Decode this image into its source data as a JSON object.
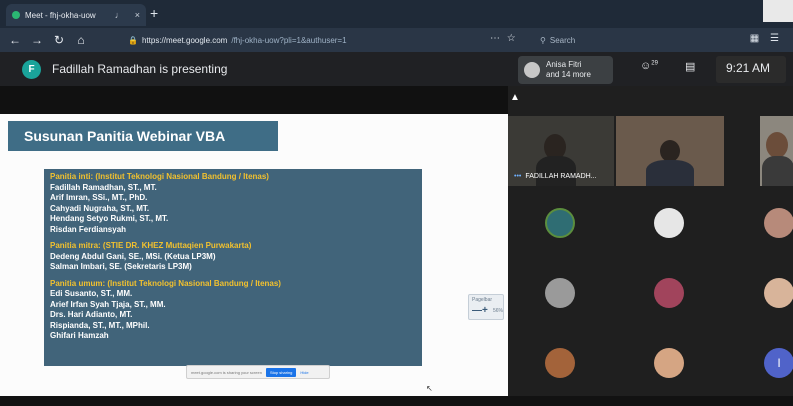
{
  "browser": {
    "tab_title": "Meet - fhj-okha-uow",
    "tab_close": "×",
    "sound_icon": "speaker-icon",
    "new_tab": "+",
    "url_host": "https://meet.google.com",
    "url_path": "/fhj-okha-uow?pli=1&authuser=1",
    "search_placeholder": "Search"
  },
  "meet": {
    "presenter_initial": "F",
    "presenting_text": "Fadillah Ramadhan is presenting",
    "participants_name": "Anisa Fitri",
    "participants_more": "and 14 more",
    "people_count": "29",
    "time": "9:21 AM"
  },
  "slide": {
    "title": "Susunan Panitia Webinar VBA",
    "lines": [
      {
        "type": "h",
        "text": "Panitia inti: (Institut Teknologi Nasional Bandung / Itenas)"
      },
      {
        "type": "n",
        "text": "Fadillah Ramadhan, ST., MT."
      },
      {
        "type": "n",
        "text": "Arif Imran, SSi., MT., PhD."
      },
      {
        "type": "n",
        "text": "Cahyadi Nugraha, ST., MT."
      },
      {
        "type": "n",
        "text": "Hendang Setyo Rukmi, ST., MT."
      },
      {
        "type": "n",
        "text": "Risdan Ferdiansyah"
      },
      {
        "type": "gap",
        "text": ""
      },
      {
        "type": "h",
        "text": "Panitia mitra: (STIE DR. KHEZ Muttaqien Purwakarta)"
      },
      {
        "type": "n",
        "text": "Dedeng Abdul Gani, SE., MSi. (Ketua LP3M)"
      },
      {
        "type": "n",
        "text": "Salman Imbari, SE. (Sekretaris LP3M)"
      },
      {
        "type": "gap",
        "text": ""
      },
      {
        "type": "h",
        "text": "Panitia umum: (Institut Teknologi Nasional Bandung / Itenas)"
      },
      {
        "type": "n",
        "text": "Edi Susanto, ST., MM."
      },
      {
        "type": "n",
        "text": "Arief Irfan Syah Tjaja, ST., MM."
      },
      {
        "type": "n",
        "text": "Drs. Hari Adianto, MT."
      },
      {
        "type": "n",
        "text": "Rispianda, ST., MT., MPhil."
      },
      {
        "type": "n",
        "text": "Ghifari Hamzah"
      }
    ],
    "zoom_title": "Pagelbar",
    "zoom_buttons": "—+",
    "zoom_value": "56%",
    "share_text": "meet.google.com is sharing your screen",
    "stop_label": "Stop sharing",
    "hide_label": "Hide"
  },
  "grid": {
    "speaker_name": "FADILLAH RAMADH...",
    "speaker_dots": "•••",
    "last_initial": "I"
  },
  "colors": {
    "title_bg": "#3f6d86",
    "content_bg": "#41647a",
    "heading_text": "#f2c12e",
    "meet_bg": "#202124"
  }
}
